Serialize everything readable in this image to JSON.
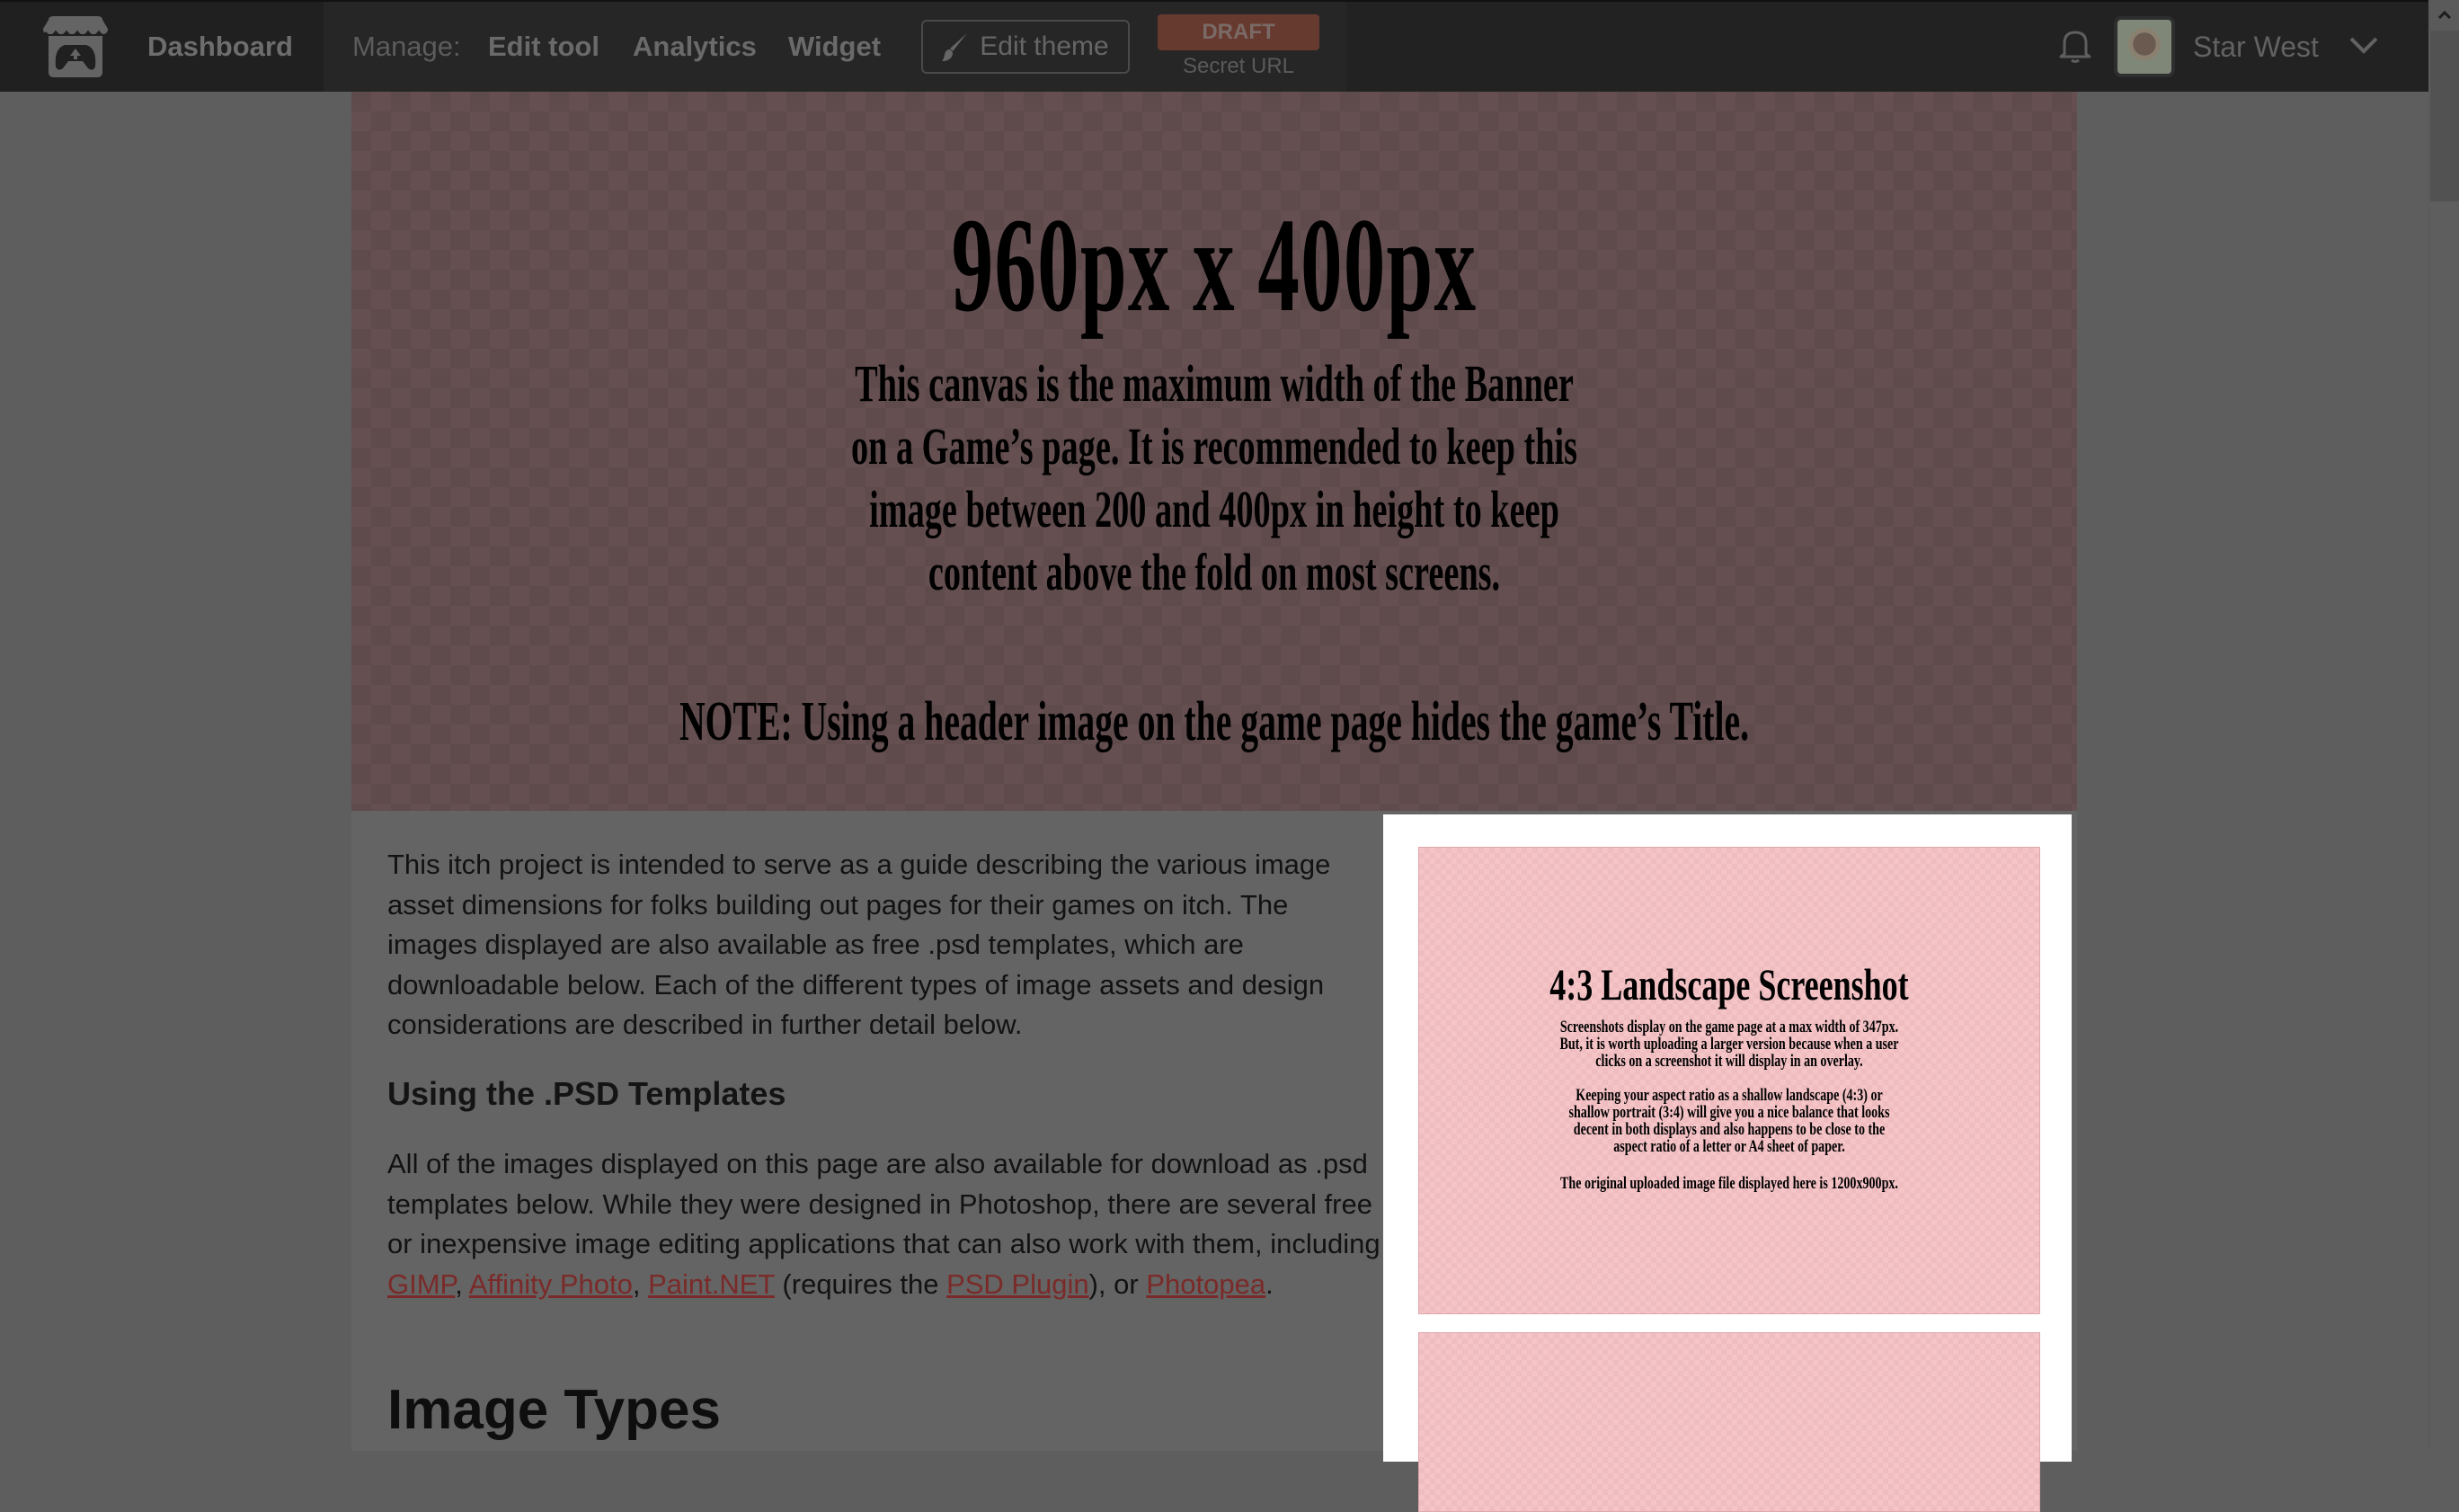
{
  "header": {
    "logo_icon": "itch-storefront-gamepad-icon",
    "dashboard_label": "Dashboard",
    "manage_label": "Manage:",
    "nav_links": [
      {
        "label": "Edit tool"
      },
      {
        "label": "Analytics"
      },
      {
        "label": "Widget"
      }
    ],
    "edit_theme": {
      "icon": "paintbrush-icon",
      "label": "Edit theme"
    },
    "status_badge": "DRAFT",
    "secret_url_label": "Secret URL",
    "notifications_icon": "bell-icon",
    "user": {
      "name": "Star West",
      "avatar": "hedgehog-avatar",
      "menu_icon": "chevron-down-icon"
    }
  },
  "colors": {
    "header_bg": "#222222",
    "draft_badge": "#673a30",
    "link": "#7a2a28",
    "page_bg": "#5e5e5e",
    "column_bg": "#646464",
    "banner_bg": "#5f4b4c",
    "screenshot_bg": "#f4c4c7"
  },
  "banner": {
    "title": "960px x 400px",
    "description_lines": [
      "This canvas is the maximum width of the  Banner",
      "on a Game’s page. It is recommended to keep this",
      "image between 200 and 400px in height to keep",
      "content above the fold on most screens."
    ],
    "note": "NOTE: Using a header image on the game page hides the game’s Title."
  },
  "content": {
    "intro": "This itch project is intended to serve as a guide describing the various image asset dimensions for folks building out pages for their games on itch. The images displayed are also available as free .psd templates, which are downloadable below. Each of the different types of image assets and design considerations are described in further detail below.",
    "psd_heading": "Using the .PSD Templates",
    "psd_paragraph": {
      "before": "All of the images displayed on this page are also available for download as .psd templates below. While they were designed in Photoshop, there are several free or inexpensive image editing applications that can also work with them, including ",
      "link_gimp": "GIMP",
      "sep1": ", ",
      "link_affinity": "Affinity Photo",
      "sep2": ", ",
      "link_paintnet": "Paint.NET",
      "mid": " (requires the ",
      "link_psd_plugin": "PSD Plugin",
      "after": "), or ",
      "link_photopea": "Photopea",
      "end": "."
    },
    "image_types_heading": "Image Types"
  },
  "screenshots": [
    {
      "title": "4:3 Landscape Screenshot",
      "para1": [
        "Screenshots display on the game page at a max width of 347px.",
        "But, it is worth uploading a larger version because when a user",
        "clicks on a screenshot it will display in an overlay."
      ],
      "para2": [
        "Keeping your aspect ratio as a shallow landscape (4:3) or",
        "shallow portrait (3:4) will give you a nice balance that looks",
        "decent in both displays and also happens to be close to the",
        "aspect ratio of a letter or A4 sheet of paper."
      ],
      "para3": [
        "The original uploaded image file displayed here is 1200x900px."
      ]
    },
    {
      "title": ""
    }
  ]
}
